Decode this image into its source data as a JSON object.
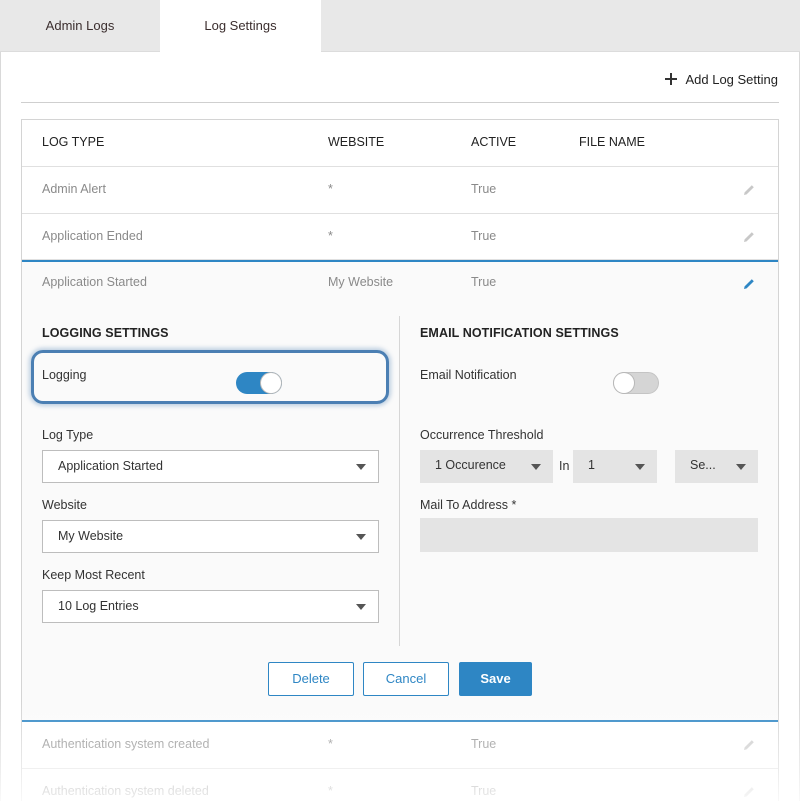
{
  "tabs": [
    {
      "label": "Admin Logs"
    },
    {
      "label": "Log Settings"
    }
  ],
  "toolbar": {
    "add_label": "Add Log Setting"
  },
  "table": {
    "headers": [
      "LOG TYPE",
      "WEBSITE",
      "ACTIVE",
      "FILE NAME"
    ],
    "rows": [
      {
        "log_type": "Admin Alert",
        "website": "*",
        "active": "True",
        "file_name": ""
      },
      {
        "log_type": "Application Ended",
        "website": "*",
        "active": "True",
        "file_name": ""
      },
      {
        "log_type": "Application Started",
        "website": "My Website",
        "active": "True",
        "file_name": ""
      },
      {
        "log_type": "Authentication system created",
        "website": "*",
        "active": "True",
        "file_name": ""
      },
      {
        "log_type": "Authentication system deleted",
        "website": "*",
        "active": "True",
        "file_name": ""
      }
    ]
  },
  "logging_settings": {
    "title": "LOGGING SETTINGS",
    "logging_label": "Logging",
    "logging_on": true,
    "log_type_label": "Log Type",
    "log_type_value": "Application Started",
    "website_label": "Website",
    "website_value": "My Website",
    "keep_label": "Keep Most Recent",
    "keep_value": "10 Log Entries"
  },
  "email_settings": {
    "title": "EMAIL NOTIFICATION SETTINGS",
    "notification_label": "Email Notification",
    "notification_on": false,
    "threshold_label": "Occurrence Threshold",
    "occurrence_value": "1 Occurence",
    "in_label": "In",
    "count_value": "1",
    "unit_value": "Se...",
    "mail_label": "Mail To Address *",
    "mail_value": ""
  },
  "actions": {
    "delete_label": "Delete",
    "cancel_label": "Cancel",
    "save_label": "Save"
  },
  "colors": {
    "accent": "#2e86c4",
    "highlight_ring": "#4b7fb3",
    "tab_bar": "#e8e8e8"
  },
  "icons": {
    "add": "plus-icon",
    "edit": "pencil-icon",
    "dropdown": "caret-down-icon"
  }
}
